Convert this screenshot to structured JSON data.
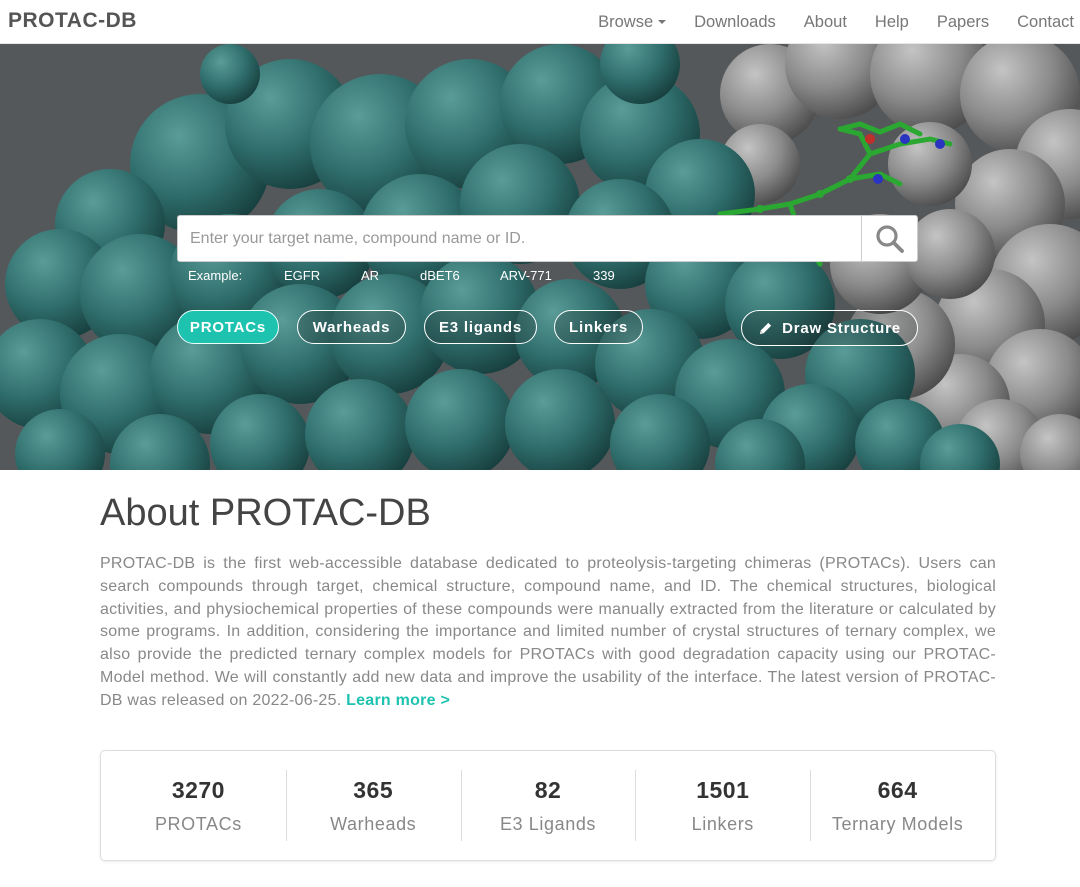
{
  "nav": {
    "brand": "PROTAC-DB",
    "items": [
      {
        "label": "Browse",
        "dropdown": true
      },
      {
        "label": "Downloads"
      },
      {
        "label": "About"
      },
      {
        "label": "Help"
      },
      {
        "label": "Papers"
      },
      {
        "label": "Contact"
      }
    ]
  },
  "search": {
    "placeholder": "Enter your target name, compound name or ID.",
    "value": "",
    "button_icon": "search-icon",
    "examples_label": "Example:",
    "examples": [
      "EGFR",
      "AR",
      "dBET6",
      "ARV-771",
      "339"
    ]
  },
  "categories": [
    {
      "label": "PROTACs",
      "active": true
    },
    {
      "label": "Warheads",
      "active": false
    },
    {
      "label": "E3 ligands",
      "active": false
    },
    {
      "label": "Linkers",
      "active": false
    }
  ],
  "draw_button": {
    "label": "Draw Structure",
    "icon": "pencil-icon"
  },
  "about": {
    "title": "About PROTAC-DB",
    "text": "PROTAC-DB is the first web-accessible database dedicated to proteolysis-targeting chimeras (PROTACs). Users can search compounds through target, chemical structure, compound name, and ID. The chemical structures, biological activities, and physiochemical properties of these compounds were manually extracted from the literature or calculated by some programs. In addition, considering the importance and limited number of crystal structures of ternary complex, we also provide the predicted ternary complex models for PROTACs with good degradation capacity using our PROTAC-Model method. We will constantly add new data and improve the usability of the interface. The latest version of PROTAC-DB was released on 2022-06-25.",
    "learn_more": "Learn more >"
  },
  "stats": [
    {
      "value": "3270",
      "label": "PROTACs"
    },
    {
      "value": "365",
      "label": "Warheads"
    },
    {
      "value": "82",
      "label": "E3 Ligands"
    },
    {
      "value": "1501",
      "label": "Linkers"
    },
    {
      "value": "664",
      "label": "Ternary Models"
    }
  ],
  "colors": {
    "accent": "#1ec3b0",
    "protein_teal": "#2f6e6c",
    "protein_gray": "#8a8a8a",
    "ligand_green": "#2aa832"
  }
}
